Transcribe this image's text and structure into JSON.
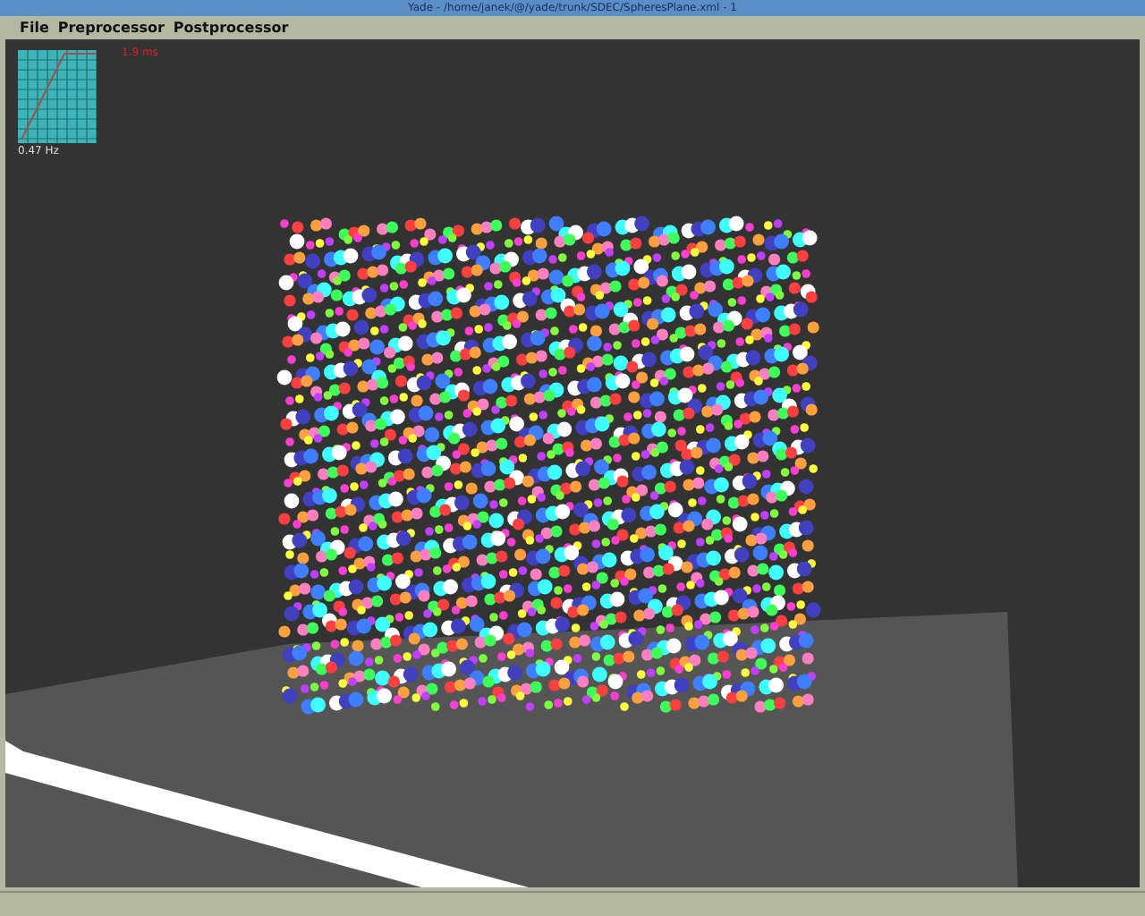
{
  "window": {
    "title": "Yade - /home/janek/@/yade/trunk/SDEC/SpheresPlane.xml - 1"
  },
  "menu": [
    {
      "label": "File"
    },
    {
      "label": "Preprocessor"
    },
    {
      "label": "Postprocessor"
    }
  ],
  "viewport": {
    "graph": {
      "top_label": "1.9 ms",
      "bottom_label": "0.47 Hz"
    }
  }
}
